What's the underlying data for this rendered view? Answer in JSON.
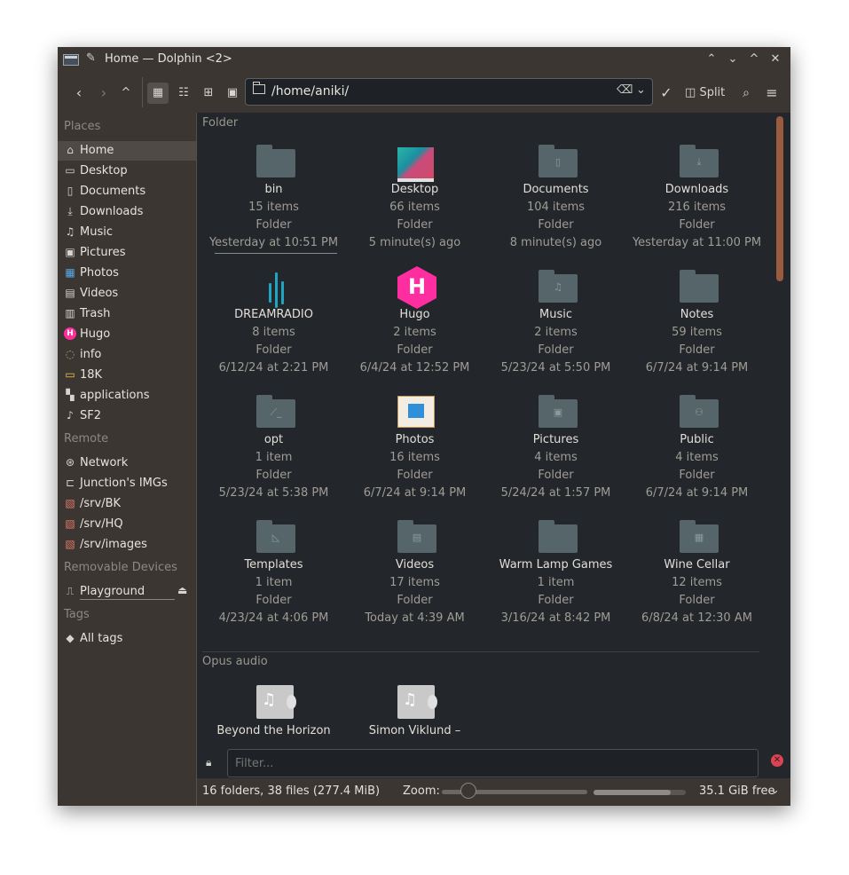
{
  "window": {
    "title": "Home — Dolphin <2>"
  },
  "toolbar": {
    "back": "<",
    "forward": ">",
    "up": "^",
    "location": "/home/aniki/",
    "split_label": "Split"
  },
  "sidebar": {
    "places_label": "Places",
    "remote_label": "Remote",
    "removable_label": "Removable Devices",
    "tags_label": "Tags",
    "places": [
      {
        "label": "Home",
        "icon": "home-icon",
        "glyph": "⌂"
      },
      {
        "label": "Desktop",
        "icon": "desktop-icon",
        "glyph": "▭"
      },
      {
        "label": "Documents",
        "icon": "documents-icon",
        "glyph": "▯"
      },
      {
        "label": "Downloads",
        "icon": "downloads-icon",
        "glyph": "⤓"
      },
      {
        "label": "Music",
        "icon": "music-icon",
        "glyph": "♫"
      },
      {
        "label": "Pictures",
        "icon": "pictures-icon",
        "glyph": "▣"
      },
      {
        "label": "Photos",
        "icon": "photos-icon",
        "glyph": "▦"
      },
      {
        "label": "Videos",
        "icon": "videos-icon",
        "glyph": "▤"
      },
      {
        "label": "Trash",
        "icon": "trash-icon",
        "glyph": "▥"
      },
      {
        "label": "Hugo",
        "icon": "hugo-icon",
        "glyph": "H"
      },
      {
        "label": "info",
        "icon": "info-folder-icon",
        "glyph": "◌"
      },
      {
        "label": "18K",
        "icon": "folder-icon",
        "glyph": "▭"
      },
      {
        "label": "applications",
        "icon": "applications-icon",
        "glyph": "▚"
      },
      {
        "label": "SF2",
        "icon": "sf2-icon",
        "glyph": "♪"
      }
    ],
    "remote": [
      {
        "label": "Network",
        "icon": "network-icon",
        "glyph": "⊛"
      },
      {
        "label": "Junction's IMGs",
        "icon": "network-folder-icon",
        "glyph": "⊏"
      },
      {
        "label": "/srv/BK",
        "icon": "server-icon",
        "glyph": "▧"
      },
      {
        "label": "/srv/HQ",
        "icon": "server-icon",
        "glyph": "▧"
      },
      {
        "label": "/srv/images",
        "icon": "server-icon",
        "glyph": "▧"
      }
    ],
    "removable": [
      {
        "label": "Playground",
        "icon": "usb-drive-icon",
        "glyph": "⎍",
        "eject": "⏏"
      }
    ],
    "tags": [
      {
        "label": "All tags",
        "icon": "tag-icon",
        "glyph": "◆"
      }
    ]
  },
  "main": {
    "folder_group_label": "Folder",
    "audio_group_label": "Opus audio",
    "folders": [
      {
        "name": "bin",
        "items": "15 items",
        "type": "Folder",
        "date": "Yesterday at 10:51 PM",
        "icon": "folder-icon",
        "glyph": ""
      },
      {
        "name": "Desktop",
        "items": "66 items",
        "type": "Folder",
        "date": "5 minute(s) ago",
        "icon": "desktop-folder-icon",
        "glyph": ""
      },
      {
        "name": "Documents",
        "items": "104 items",
        "type": "Folder",
        "date": "8 minute(s) ago",
        "icon": "documents-folder-icon",
        "glyph": "▯"
      },
      {
        "name": "Downloads",
        "items": "216 items",
        "type": "Folder",
        "date": "Yesterday at 11:00 PM",
        "icon": "downloads-folder-icon",
        "glyph": "⤓"
      },
      {
        "name": "DREAMRADIO",
        "items": "8 items",
        "type": "Folder",
        "date": "6/12/24 at 2:21 PM",
        "icon": "dreamradio-icon",
        "glyph": ""
      },
      {
        "name": "Hugo",
        "items": "2 items",
        "type": "Folder",
        "date": "6/4/24 at 12:52 PM",
        "icon": "hugo-icon",
        "glyph": ""
      },
      {
        "name": "Music",
        "items": "2 items",
        "type": "Folder",
        "date": "5/23/24 at 5:50 PM",
        "icon": "music-folder-icon",
        "glyph": "♫"
      },
      {
        "name": "Notes",
        "items": "59 items",
        "type": "Folder",
        "date": "6/7/24 at 9:14 PM",
        "icon": "folder-icon",
        "glyph": ""
      },
      {
        "name": "opt",
        "items": "1 item",
        "type": "Folder",
        "date": "5/23/24 at 5:38 PM",
        "icon": "opt-folder-icon",
        "glyph": "⟋_"
      },
      {
        "name": "Photos",
        "items": "16 items",
        "type": "Folder",
        "date": "6/7/24 at 9:14 PM",
        "icon": "photos-folder-icon",
        "glyph": ""
      },
      {
        "name": "Pictures",
        "items": "4 items",
        "type": "Folder",
        "date": "5/24/24 at 1:57 PM",
        "icon": "pictures-folder-icon",
        "glyph": "▣"
      },
      {
        "name": "Public",
        "items": "4 items",
        "type": "Folder",
        "date": "6/7/24 at 9:14 PM",
        "icon": "public-folder-icon",
        "glyph": "⚇"
      },
      {
        "name": "Templates",
        "items": "1 item",
        "type": "Folder",
        "date": "4/23/24 at 4:06 PM",
        "icon": "templates-folder-icon",
        "glyph": "◺"
      },
      {
        "name": "Videos",
        "items": "17 items",
        "type": "Folder",
        "date": "Today at 4:39 AM",
        "icon": "videos-folder-icon",
        "glyph": "▤"
      },
      {
        "name": "Warm Lamp Games",
        "items": "1 item",
        "type": "Folder",
        "date": "3/16/24 at 8:42 PM",
        "icon": "folder-icon",
        "glyph": ""
      },
      {
        "name": "Wine Cellar",
        "items": "12 items",
        "type": "Folder",
        "date": "6/8/24 at 12:30 AM",
        "icon": "wine-folder-icon",
        "glyph": "▦"
      }
    ],
    "audio_files": [
      {
        "name": "Beyond the Horizon",
        "icon": "audio-file-icon"
      },
      {
        "name": "Simon Viklund –",
        "icon": "audio-file-icon"
      }
    ]
  },
  "filter": {
    "placeholder": "Filter..."
  },
  "status": {
    "summary": "16 folders, 38 files (277.4 MiB)",
    "zoom_label": "Zoom:",
    "zoom_level": 0.18,
    "disk_used_fraction": 0.84,
    "free_space": "35.1 GiB free"
  }
}
